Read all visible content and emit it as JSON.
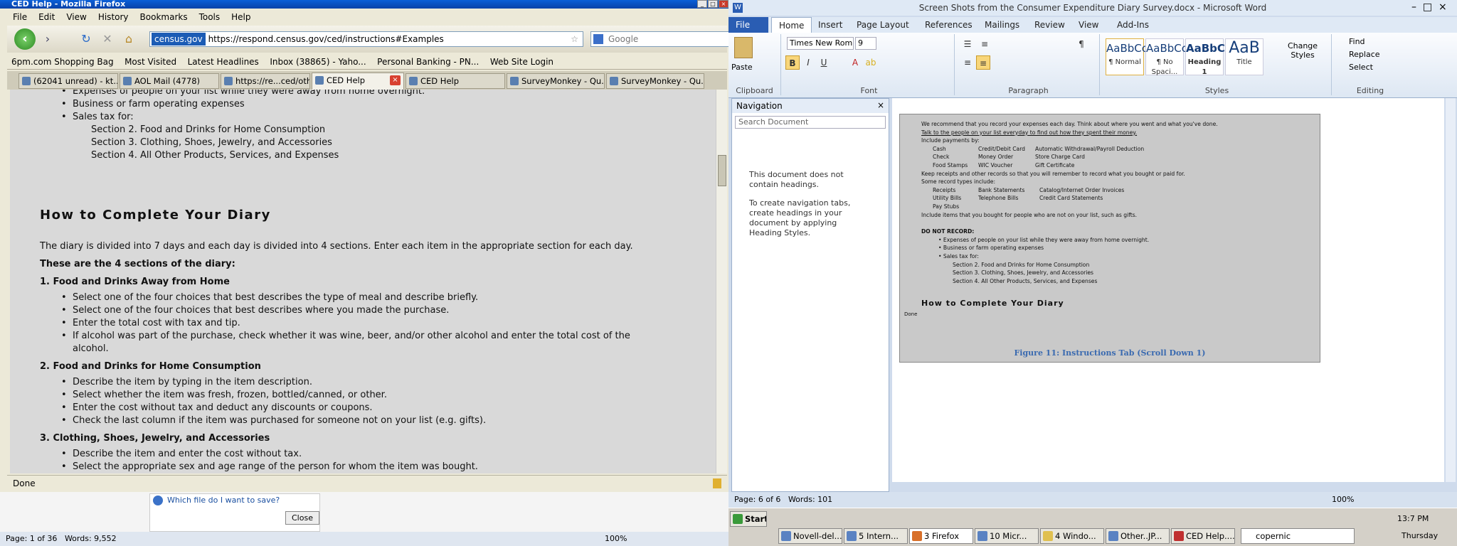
{
  "firefox": {
    "title": "CED Help - Mozilla Firefox",
    "menu": [
      "File",
      "Edit",
      "View",
      "History",
      "Bookmarks",
      "Tools",
      "Help"
    ],
    "url_site": "census.gov",
    "url": "https://respond.census.gov/ced/instructions#Examples",
    "search_placeholder": "Google",
    "bookmarks": [
      "6pm.com Shopping Bag",
      "Most Visited",
      "Latest Headlines",
      "Inbox (38865) - Yaho...",
      "Personal Banking - PN...",
      "Web Site Login"
    ],
    "tabs": [
      "(62041 unread) - kt...",
      "AOL Mail (4778)",
      "https://re...ced/other",
      "CED Help",
      "CED Help",
      "SurveyMonkey - Qu...",
      "SurveyMonkey - Qu..."
    ],
    "status": "Done",
    "content": {
      "lines_top": [
        "Expenses of people on your list while they were away from home overnight.",
        "Business or farm operating expenses",
        "Sales tax for:"
      ],
      "sections_list": [
        "Section 2. Food and Drinks for Home Consumption",
        "Section 3. Clothing, Shoes, Jewelry, and Accessories",
        "Section 4. All Other Products, Services, and Expenses"
      ],
      "heading": "How to Complete Your Diary",
      "intro": "The diary is divided into 7 days and each day is divided into 4 sections. Enter each item in the appropriate section for each day.",
      "sections_title": "These are the 4 sections of the diary:",
      "s1_title": "1. Food and Drinks Away from Home",
      "s1_items": [
        "Select one of the four choices that best describes the type of meal and describe briefly.",
        "Select one of the four choices that best describes where you made the purchase.",
        "Enter the total cost with tax and tip.",
        "If alcohol was part of the purchase, check whether it was wine, beer, and/or other alcohol and enter the total cost of the",
        "alcohol."
      ],
      "s2_title": "2. Food and Drinks for Home Consumption",
      "s2_items": [
        "Describe the item by typing in the item description.",
        "Select whether the item was fresh, frozen, bottled/canned, or other.",
        "Enter the cost without tax and deduct any discounts or coupons.",
        "Check the last column if the item was purchased for someone not on your list (e.g. gifts)."
      ],
      "s3_title": "3. Clothing, Shoes, Jewelry, and Accessories",
      "s3_items": [
        "Describe the item and enter the cost without tax.",
        "Select the appropriate sex and age range of the person for whom the item was bought."
      ]
    }
  },
  "under": {
    "help_text": "Which file do I want to save?",
    "close_label": "Close",
    "page": "Page: 1 of 36",
    "words": "Words: 9,552",
    "zoom": "100%"
  },
  "word": {
    "title": "Screen Shots from the Consumer Expenditure Diary Survey.docx - Microsoft Word",
    "tabs": [
      "File",
      "Home",
      "Insert",
      "Page Layout",
      "References",
      "Mailings",
      "Review",
      "View",
      "Add-Ins"
    ],
    "font_name": "Times New Rom",
    "font_size": "9",
    "groups": [
      "Clipboard",
      "Font",
      "Paragraph",
      "Styles",
      "Editing"
    ],
    "paste": "Paste",
    "styles": [
      {
        "sample": "AaBbCcI",
        "name": "¶ Normal"
      },
      {
        "sample": "AaBbCcI",
        "name": "¶ No Spaci..."
      },
      {
        "sample": "AaBbC(",
        "name": "Heading 1"
      },
      {
        "sample": "AaB",
        "name": "Title"
      }
    ],
    "change_styles": "Change Styles",
    "editing": [
      "Find",
      "Replace",
      "Select"
    ],
    "nav_title": "Navigation",
    "nav_search": "Search Document",
    "nav_msg1": "This document does not contain headings.",
    "nav_msg2": "To create navigation tabs, create headings in your document by applying Heading Styles.",
    "caption": "Figure 11: Instructions Tab (Scroll Down 1)",
    "status_page": "Page: 6 of 6",
    "status_words": "Words: 101",
    "zoom": "100%",
    "doc": {
      "l1": "We recommend that you record your expenses each day. Think about where you went and what you've done.",
      "l2": "Talk to the people on your list everyday to find out how they spent their money.",
      "l3": "Include payments by:",
      "pay": [
        [
          "Cash",
          "Credit/Debit Card",
          "Automatic Withdrawal/Payroll Deduction"
        ],
        [
          "Check",
          "Money Order",
          "Store Charge Card"
        ],
        [
          "Food Stamps",
          "WIC Voucher",
          "Gift Certificate"
        ]
      ],
      "l4": "Keep receipts and other records so that you will remember to record what you bought or paid for.",
      "l5": "Some record types include:",
      "rec": [
        [
          "Receipts",
          "Bank Statements",
          "Catalog/Internet Order Invoices"
        ],
        [
          "Utility Bills",
          "Telephone Bills",
          "Credit Card Statements"
        ],
        [
          "Pay Stubs",
          "",
          ""
        ]
      ],
      "l6": "Include items that you bought for people who are not on your list, such as gifts.",
      "dnr": "DO NOT RECORD:",
      "dnr_items": [
        "Expenses of people on your list while they were away from home overnight.",
        "Business or farm operating expenses",
        "Sales tax for:"
      ],
      "secs": [
        "Section 2. Food and Drinks for Home Consumption",
        "Section 3. Clothing, Shoes, Jewelry, and Accessories",
        "Section 4. All Other Products, Services, and Expenses"
      ],
      "heading": "How to Complete Your Diary",
      "done": "Done"
    }
  },
  "taskbar": {
    "start": "Start",
    "items": [
      "Novell-del...",
      "5 Intern...",
      "3 Firefox",
      "10 Micr...",
      "4 Windo...",
      "Other..JP...",
      "CED Help...."
    ],
    "search": "copernic",
    "time": "13:7 PM",
    "day": "Thursday"
  }
}
